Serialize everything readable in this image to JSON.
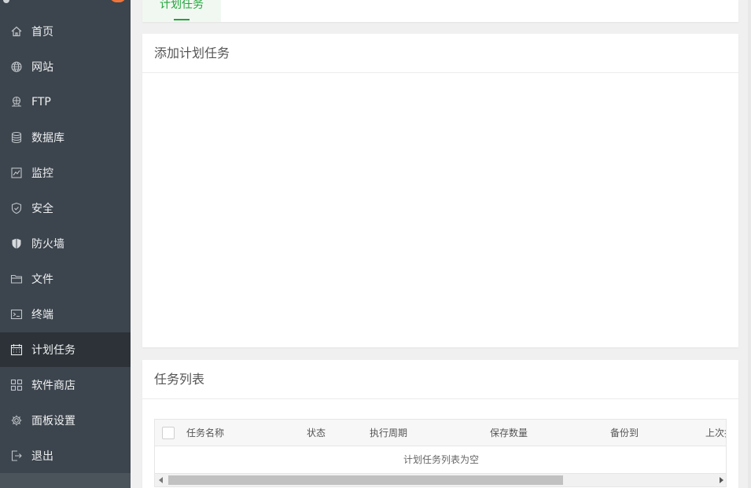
{
  "sidebar": {
    "items": [
      {
        "label": "首页",
        "icon": "home-icon"
      },
      {
        "label": "网站",
        "icon": "globe-icon"
      },
      {
        "label": "FTP",
        "icon": "ftp-icon"
      },
      {
        "label": "数据库",
        "icon": "database-icon"
      },
      {
        "label": "监控",
        "icon": "monitor-icon"
      },
      {
        "label": "安全",
        "icon": "shield-check-icon"
      },
      {
        "label": "防火墙",
        "icon": "firewall-icon"
      },
      {
        "label": "文件",
        "icon": "folder-icon"
      },
      {
        "label": "终端",
        "icon": "terminal-icon"
      },
      {
        "label": "计划任务",
        "icon": "calendar-icon",
        "active": true
      },
      {
        "label": "软件商店",
        "icon": "apps-icon"
      },
      {
        "label": "面板设置",
        "icon": "gear-icon"
      },
      {
        "label": "退出",
        "icon": "logout-icon"
      }
    ]
  },
  "tabs": {
    "active_label": "计划任务"
  },
  "add_task": {
    "title": "添加计划任务"
  },
  "task_list": {
    "title": "任务列表",
    "columns": [
      "任务名称",
      "状态",
      "执行周期",
      "保存数量",
      "备份到",
      "上次执"
    ],
    "empty_text": "计划任务列表为空"
  },
  "colors": {
    "accent": "#20a53a",
    "sidebar_bg": "#3c444d",
    "sidebar_active_bg": "#2c3238",
    "badge": "#f0743a"
  }
}
